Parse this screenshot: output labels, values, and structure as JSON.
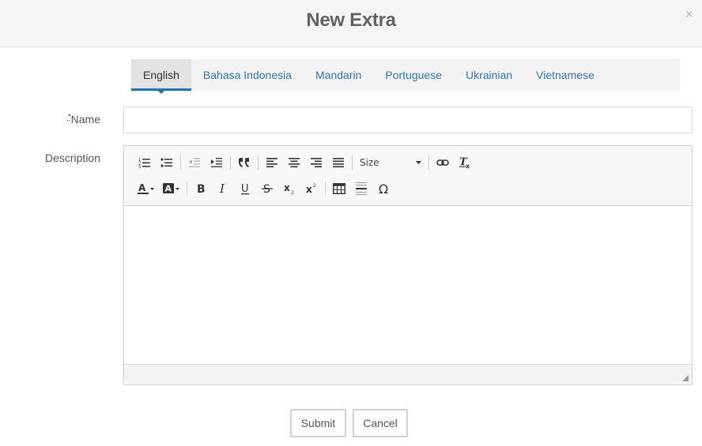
{
  "modal": {
    "title": "New Extra",
    "close_glyph": "×"
  },
  "tabs": [
    {
      "label": "English",
      "active": true
    },
    {
      "label": "Bahasa Indonesia",
      "active": false
    },
    {
      "label": "Mandarin",
      "active": false
    },
    {
      "label": "Portuguese",
      "active": false
    },
    {
      "label": "Ukrainian",
      "active": false
    },
    {
      "label": "Vietnamese",
      "active": false
    }
  ],
  "form": {
    "required_marker": "*",
    "name_label": "Name",
    "name_value": "",
    "description_label": "Description"
  },
  "toolbar": {
    "size_label": "Size",
    "row1_icons": [
      "numbered-list-icon",
      "bulleted-list-icon",
      "outdent-icon",
      "indent-icon",
      "blockquote-icon",
      "align-left-icon",
      "align-center-icon",
      "align-right-icon",
      "align-justify-icon",
      "link-icon",
      "remove-format-icon"
    ],
    "row2_icons": [
      "text-color-icon",
      "background-color-icon",
      "bold-icon",
      "italic-icon",
      "underline-icon",
      "strikethrough-icon",
      "subscript-icon",
      "superscript-icon",
      "table-icon",
      "horizontal-line-icon",
      "special-character-icon"
    ],
    "special_char_glyph": "Ω"
  },
  "buttons": {
    "submit": "Submit",
    "cancel": "Cancel"
  }
}
